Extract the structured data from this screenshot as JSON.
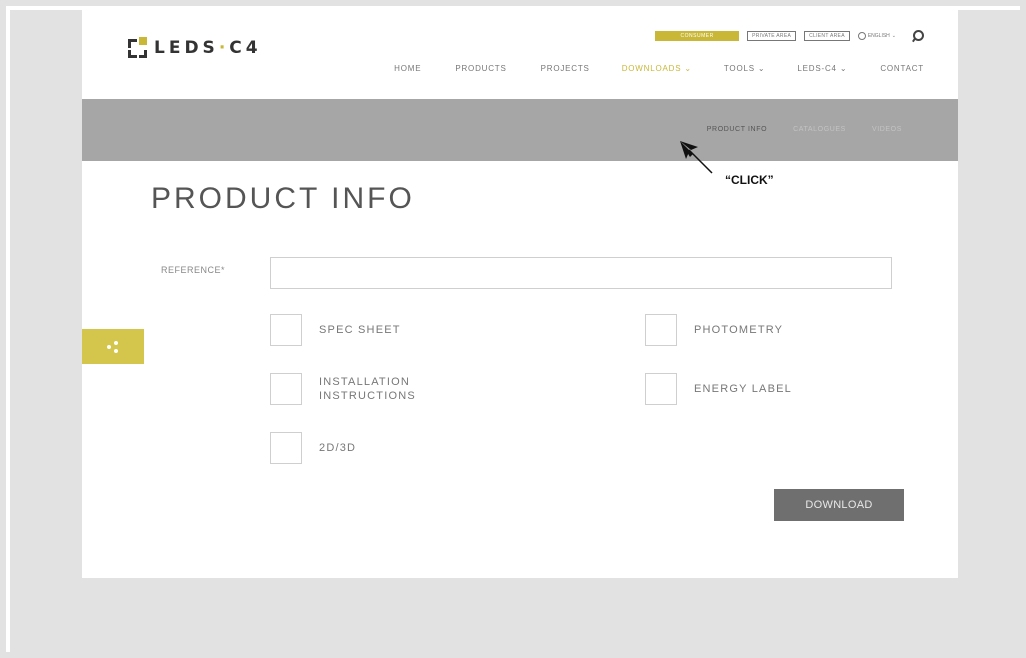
{
  "header": {
    "logo_text": "LEDS",
    "logo_sep": "·",
    "logo_text2": "C4",
    "top_buttons": [
      "CONSUMER",
      "PRIVATE AREA",
      "CLIENT AREA"
    ],
    "language": "ENGLISH",
    "nav": [
      "HOME",
      "PRODUCTS",
      "PROJECTS",
      "DOWNLOADS",
      "TOOLS",
      "LEDS-C4",
      "CONTACT"
    ]
  },
  "subnav": [
    "PRODUCT INFO",
    "CATALOGUES",
    "VIDEOS"
  ],
  "page_title": "PRODUCT INFO",
  "form": {
    "reference_label": "REFERENCE*",
    "reference_value": "",
    "options": {
      "spec_sheet": "SPEC SHEET",
      "photometry": "PHOTOMETRY",
      "installation_line1": "INSTALLATION",
      "installation_line2": "INSTRUCTIONS",
      "energy_label": "ENERGY LABEL",
      "twod_threed": "2D/3D"
    },
    "download_label": "DOWNLOAD"
  },
  "annotation": {
    "click_text": "“CLICK”"
  },
  "colors": {
    "accent": "#c9b838",
    "subbar": "#a6a6a6",
    "button": "#6f6f6f"
  },
  "icons": [
    "logo-icon",
    "globe-icon",
    "search-icon",
    "share-icon",
    "cursor-arrow-icon"
  ]
}
